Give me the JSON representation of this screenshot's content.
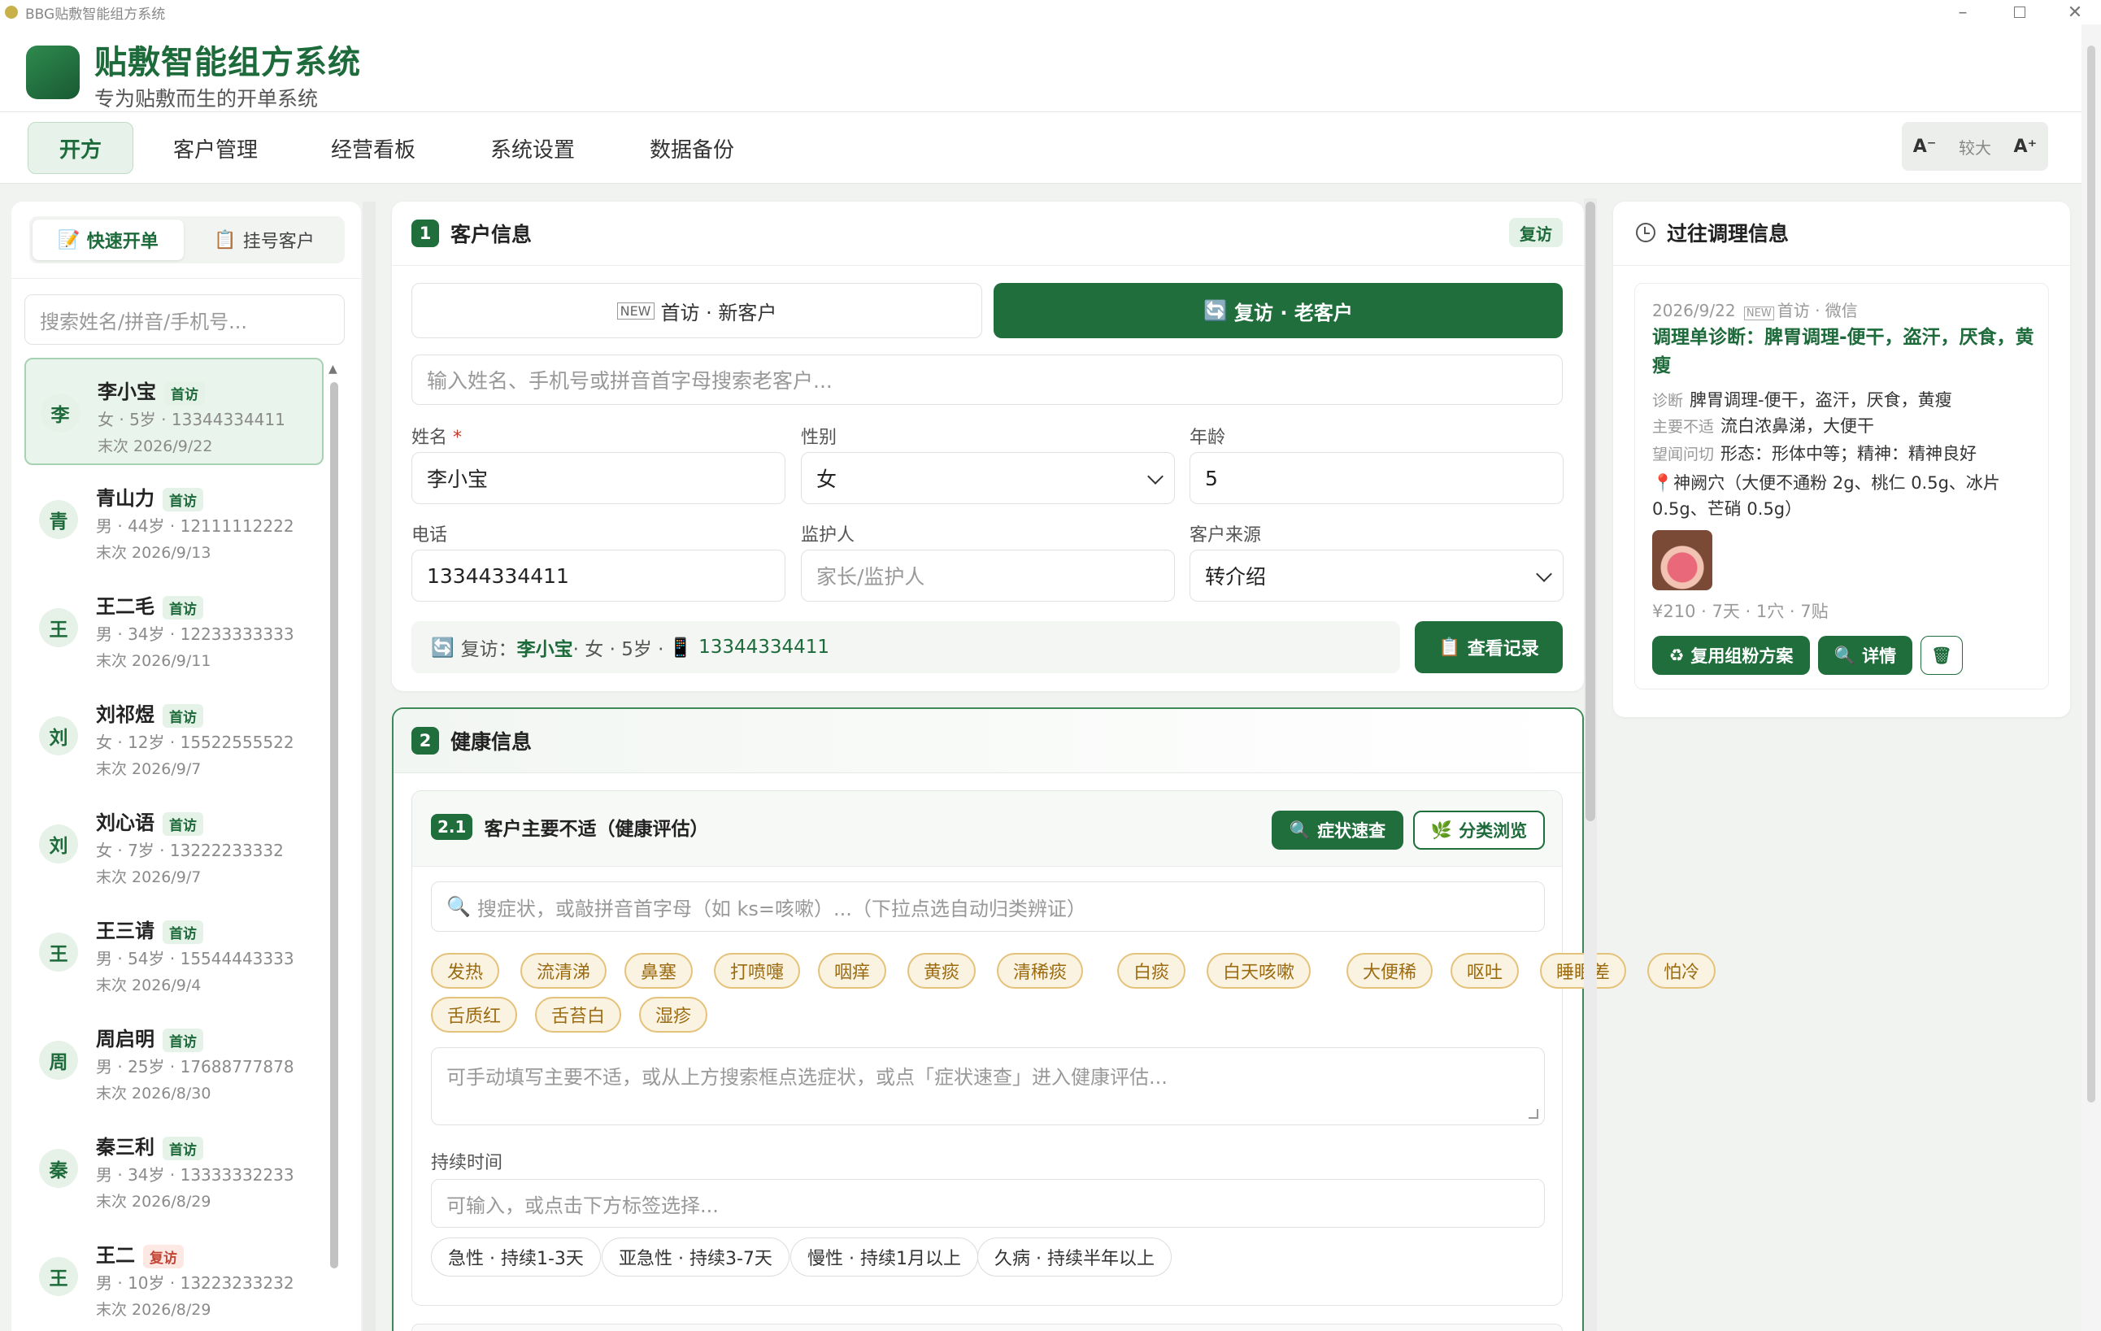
{
  "window": {
    "title": "BBG贴敷智能组方系统"
  },
  "brand": {
    "title": "贴敷智能组方系统",
    "slogan": "专为贴敷而生的开单系统"
  },
  "nav": {
    "tabs": [
      "开方",
      "客户管理",
      "经营看板",
      "系统设置",
      "数据备份"
    ],
    "active": 0
  },
  "font_control": {
    "decrease": "A⁻",
    "level": "较大",
    "increase": "A⁺"
  },
  "left": {
    "tabs": [
      "快速开单",
      "挂号客户"
    ],
    "search_placeholder": "搜索姓名/拼音/手机号...",
    "customers": [
      {
        "avatar": "李",
        "name": "李小宝",
        "tag": "首访",
        "meta": "女 · 5岁 · 13344334411",
        "date": "末次 2026/9/22",
        "selected": true
      },
      {
        "avatar": "青",
        "name": "青山力",
        "tag": "首访",
        "meta": "男 · 44岁 · 12111112222",
        "date": "末次 2026/9/13"
      },
      {
        "avatar": "王",
        "name": "王二毛",
        "tag": "首访",
        "meta": "男 · 34岁 · 12233333333",
        "date": "末次 2026/9/11"
      },
      {
        "avatar": "刘",
        "name": "刘祁煜",
        "tag": "首访",
        "meta": "女 · 12岁 · 15522555522",
        "date": "末次 2026/9/7"
      },
      {
        "avatar": "刘",
        "name": "刘心语",
        "tag": "首访",
        "meta": "女 · 7岁 · 13222233332",
        "date": "末次 2026/9/7"
      },
      {
        "avatar": "王",
        "name": "王三请",
        "tag": "首访",
        "meta": "男 · 54岁 · 15544443333",
        "date": "末次 2026/9/4"
      },
      {
        "avatar": "周",
        "name": "周启明",
        "tag": "首访",
        "meta": "男 · 25岁 · 17688777878",
        "date": "末次 2026/8/30"
      },
      {
        "avatar": "秦",
        "name": "秦三利",
        "tag": "首访",
        "meta": "男 · 34岁 · 13333332233",
        "date": "末次 2026/8/29"
      },
      {
        "avatar": "王",
        "name": "王二",
        "tag": "复访",
        "meta": "男 · 10岁 · 13223233232",
        "date": "末次 2026/8/29"
      }
    ]
  },
  "section1": {
    "num": "1",
    "title": "客户信息",
    "badge": "复访",
    "mode_new": "首访 · 新客户",
    "mode_return": "复访 · 老客户",
    "search_placeholder": "输入姓名、手机号或拼音首字母搜索老客户...",
    "labels": {
      "name": "姓名",
      "required": "*",
      "gender": "性别",
      "age": "年龄",
      "phone": "电话",
      "guardian": "监护人",
      "source": "客户来源"
    },
    "values": {
      "name": "李小宝",
      "gender": "女",
      "age": "5",
      "phone": "13344334411",
      "source": "转介绍"
    },
    "guardian_placeholder": "家长/监护人",
    "summary": {
      "prefix": "复访：",
      "name": "李小宝",
      "info": " · 女 · 5岁 · ",
      "phone": "13344334411"
    },
    "view_records": "查看记录"
  },
  "section2": {
    "num": "2",
    "title": "健康信息",
    "sub": {
      "num": "2.1",
      "title": "客户主要不适（健康评估）",
      "quick": "症状速查",
      "browse": "分类浏览"
    },
    "symptom_search_placeholder": "搜症状，或敲拼音首字母（如 ks=咳嗽）...（下拉点选自动归类辨证）",
    "symptoms": [
      "发热",
      "流清涕",
      "鼻塞",
      "打喷嚏",
      "咽痒",
      "黄痰",
      "清稀痰",
      "白痰",
      "白天咳嗽",
      "大便稀",
      "呕吐",
      "睡眠差",
      "怕冷",
      "舌质红",
      "舌苔白",
      "湿疹"
    ],
    "complaint_placeholder": "可手动填写主要不适，或从上方搜索框点选症状，或点「症状速查」进入健康评估...",
    "duration_label": "持续时间",
    "duration_placeholder": "可输入，或点击下方标签选择...",
    "durations": [
      "急性 · 持续1-3天",
      "亚急性 · 持续3-7天",
      "慢性 · 持续1月以上",
      "久病 · 持续半年以上"
    ]
  },
  "history": {
    "title": "过往调理信息",
    "record": {
      "date": "2026/9/22",
      "visit": "首访 · 微信",
      "diagnosis_title": "调理单诊断：脾胃调理-便干，盗汗，厌食，黄瘦",
      "diag_label": "诊断",
      "diag": "脾胃调理-便干，盗汗，厌食，黄瘦",
      "complaint_label": "主要不适",
      "complaint": "流白浓鼻涕，大便干",
      "exam_label": "望闻问切",
      "exam": "形态：形体中等；精神：精神良好",
      "acupoint": "神阙穴（大便不通粉 2g、桃仁 0.5g、冰片 0.5g、芒硝 0.5g）",
      "price": "¥210 · 7天 · 1穴 · 7贴",
      "reuse": "复用组粉方案",
      "detail": "详情"
    }
  },
  "colors": {
    "primary": "#1f6e3c",
    "accent_tag": "#e5c27a"
  }
}
